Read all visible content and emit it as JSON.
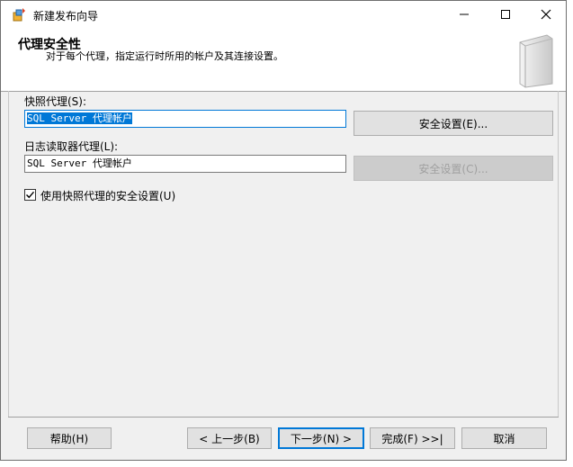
{
  "window": {
    "title": "新建发布向导",
    "controls": {
      "minimize": "—",
      "maximize": "☐",
      "close": "✕"
    }
  },
  "header": {
    "title": "代理安全性",
    "subtitle": "对于每个代理，指定运行时所用的帐户及其连接设置。"
  },
  "snapshot_agent": {
    "label": "快照代理(S):",
    "value": "SQL Server 代理帐户",
    "button": "安全设置(E)..."
  },
  "log_reader_agent": {
    "label": "日志读取器代理(L):",
    "value": "SQL Server 代理帐户",
    "button": "安全设置(C)..."
  },
  "use_snapshot_security": {
    "label": "使用快照代理的安全设置(U)",
    "checked": true
  },
  "footer": {
    "help": "帮助(H)",
    "back": "< 上一步(B)",
    "next": "下一步(N) >",
    "finish": "完成(F) >>|",
    "cancel": "取消"
  },
  "colors": {
    "accent": "#0078d7",
    "face": "#f0f0f0",
    "disabled": "#a0a0a0"
  },
  "icons": {
    "app": "wizard-icon",
    "check": "checkmark-icon"
  }
}
